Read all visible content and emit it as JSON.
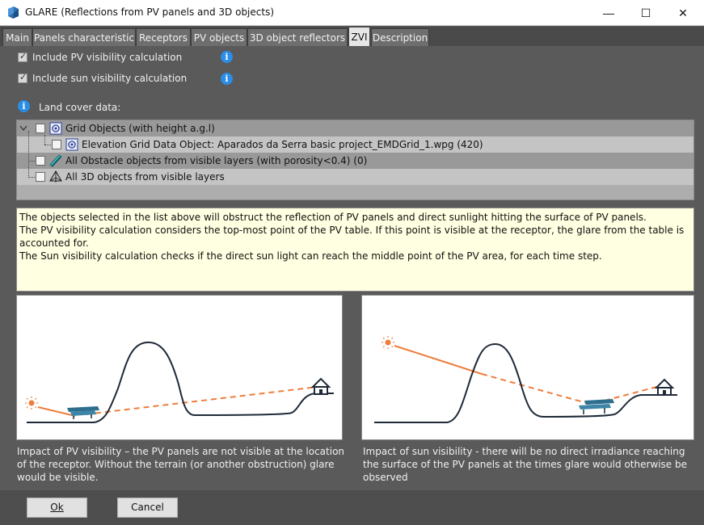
{
  "window": {
    "title": "GLARE (Reflections from PV panels and 3D objects)",
    "minimize": "—",
    "maximize": "☐",
    "close": "✕"
  },
  "tabs": [
    {
      "label": "Main"
    },
    {
      "label": "Panels characteristic"
    },
    {
      "label": "Receptors"
    },
    {
      "label": "PV objects"
    },
    {
      "label": "3D object reflectors"
    },
    {
      "label": "ZVI"
    },
    {
      "label": "Description"
    }
  ],
  "active_tab": "ZVI",
  "options": {
    "pv_visibility": {
      "label": "Include PV visibility calculation",
      "checked": true
    },
    "sun_visibility": {
      "label": "Include sun visibility calculation",
      "checked": true
    }
  },
  "land_cover": {
    "label": "Land cover data:",
    "items": [
      {
        "label": "Grid Objects (with height a.g.l)",
        "checked": false
      },
      {
        "label": "Elevation Grid Data Object: Aparados da Serra basic project_EMDGrid_1.wpg (420)",
        "checked": false
      },
      {
        "label": "All Obstacle objects from visible layers (with porosity<0.4) (0)",
        "checked": false
      },
      {
        "label": "All 3D objects from visible layers",
        "checked": false
      }
    ]
  },
  "description": {
    "line1": "The objects selected in the list above will obstruct the reflection of PV panels and direct sunlight hitting the surface of PV panels.",
    "line2": "The PV visibility calculation considers the top-most point of the PV table. If this point is visible at the receptor, the glare from the table is accounted for.",
    "line3": "The Sun visibility calculation checks if the direct sun light can reach the middle point of the PV area, for each time step."
  },
  "captions": {
    "left": "Impact of PV visibility – the PV panels are not visible at the location of the receptor. Without the terrain (or another obstruction) glare would be visible.",
    "right": "Impact of sun visibility - there will be no direct irradiance reaching the surface of the PV panels at the times glare would otherwise be observed"
  },
  "buttons": {
    "ok": "Ok",
    "cancel": "Cancel"
  },
  "colors": {
    "info_blue": "#2a8ee8",
    "ray_orange": "#ee7d3b",
    "terrain": "#1e2a38",
    "panel_blue": "#2e6f8e",
    "description_bg": "#ffffe1"
  }
}
